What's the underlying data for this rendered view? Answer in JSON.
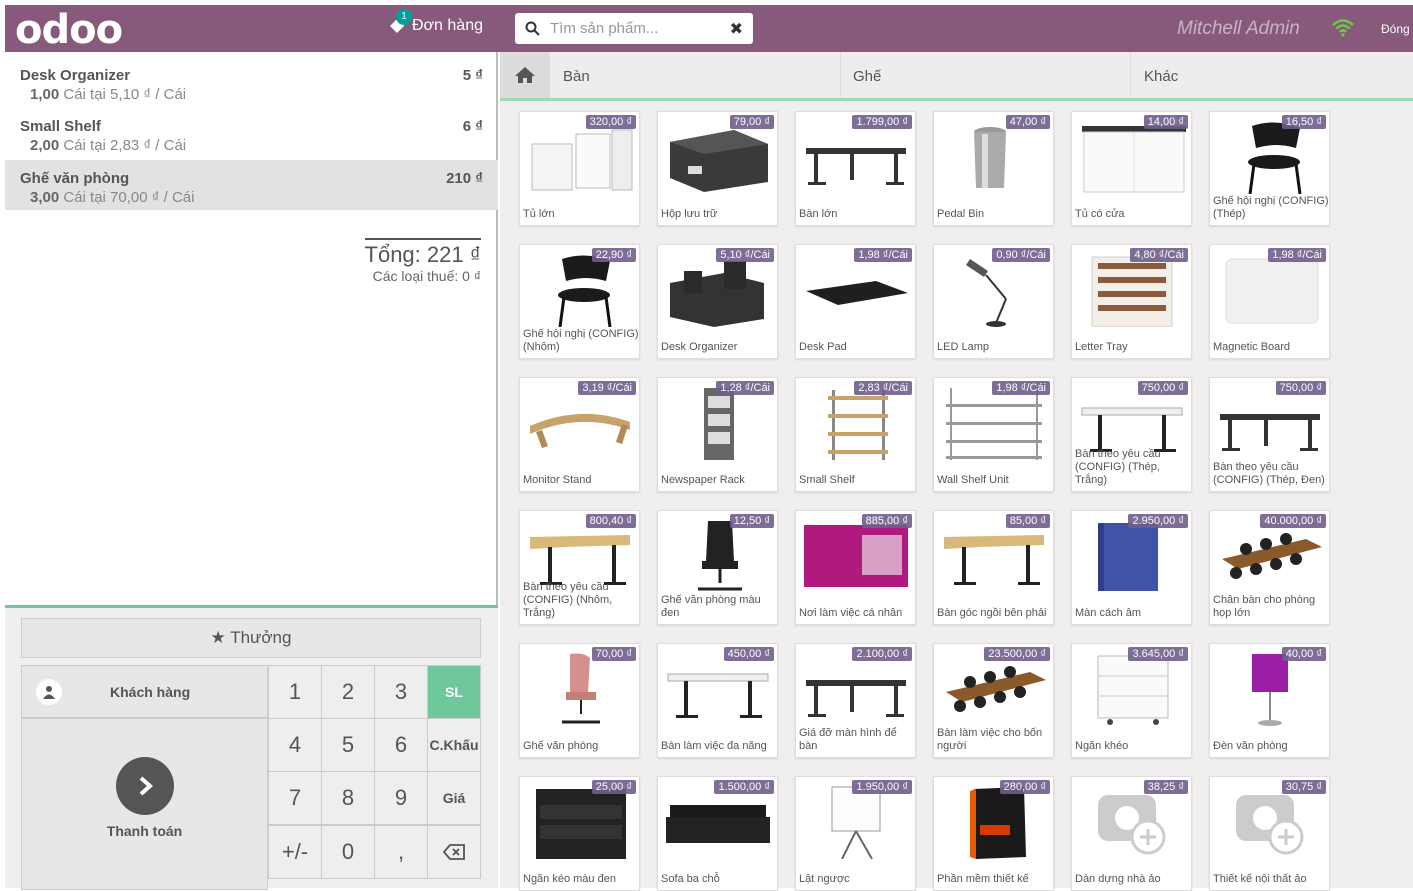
{
  "app": {
    "logo": "odoo",
    "orders_label": "Đơn hàng",
    "orders_count": "1",
    "search_placeholder": "Tìm sản phẩm...",
    "user": "Mitchell Admin",
    "close_label": "Đóng"
  },
  "order": {
    "lines": [
      {
        "name": "Desk Organizer",
        "price": "5 ₫",
        "qty": "1,00",
        "info": "Cái tại 5,10 ₫ / Cái"
      },
      {
        "name": "Small Shelf",
        "price": "6 ₫",
        "qty": "2,00",
        "info": "Cái tại 2,83 ₫ / Cái"
      },
      {
        "name": "Ghế văn phòng",
        "price": "210 ₫",
        "qty": "3,00",
        "info": "Cái tại 70,00 ₫ / Cái"
      }
    ],
    "total": "Tổng: 221 ₫",
    "taxes": "Các loại thuế: 0 ₫"
  },
  "pad": {
    "reward": "Thưởng",
    "customer": "Khách hàng",
    "payment": "Thanh toán",
    "keys": [
      "1",
      "2",
      "3",
      "SL",
      "4",
      "5",
      "6",
      "C.Khấu",
      "7",
      "8",
      "9",
      "Giá",
      "+/-",
      "0",
      ","
    ],
    "active_key": "SL"
  },
  "categories": [
    "Bàn",
    "Ghế",
    "Khác"
  ],
  "products": [
    {
      "name": "Tủ lớn",
      "price": "320,00 ₫",
      "icon": "cabinet"
    },
    {
      "name": "Hộp lưu trữ",
      "price": "79,00 ₫",
      "icon": "box"
    },
    {
      "name": "Bàn lớn",
      "price": "1.799,00 ₫",
      "icon": "desk-dark"
    },
    {
      "name": "Pedal Bin",
      "price": "47,00 ₫",
      "icon": "bin"
    },
    {
      "name": "Tủ có cửa",
      "price": "14,00 ₫",
      "icon": "cabinet-white"
    },
    {
      "name": "Ghế hội nghị (CONFIG) (Thép)",
      "price": "16,50 ₫",
      "icon": "chair"
    },
    {
      "name": "Ghế hội nghị (CONFIG) (Nhôm)",
      "price": "22,90 ₫",
      "icon": "chair"
    },
    {
      "name": "Desk Organizer",
      "price": "5,10 ₫/Cái",
      "icon": "organizer"
    },
    {
      "name": "Desk Pad",
      "price": "1,98 ₫/Cái",
      "icon": "pad"
    },
    {
      "name": "LED Lamp",
      "price": "0,90 ₫/Cái",
      "icon": "lamp"
    },
    {
      "name": "Letter Tray",
      "price": "4,80 ₫/Cái",
      "icon": "tray"
    },
    {
      "name": "Magnetic Board",
      "price": "1,98 ₫/Cái",
      "icon": "board"
    },
    {
      "name": "Monitor Stand",
      "price": "3,19 ₫/Cái",
      "icon": "stand"
    },
    {
      "name": "Newspaper Rack",
      "price": "1,28 ₫/Cái",
      "icon": "rack"
    },
    {
      "name": "Small Shelf",
      "price": "2,83 ₫/Cái",
      "icon": "shelf"
    },
    {
      "name": "Wall Shelf Unit",
      "price": "1,98 ₫/Cái",
      "icon": "wallshelf"
    },
    {
      "name": "Bàn theo yêu cầu (CONFIG) (Thép, Trắng)",
      "price": "750,00 ₫",
      "icon": "desk-white"
    },
    {
      "name": "Bàn theo yêu cầu (CONFIG) (Thép, Đen)",
      "price": "750,00 ₫",
      "icon": "desk-dark"
    },
    {
      "name": "Bàn theo yêu cầu (CONFIG) (Nhôm, Trắng)",
      "price": "800,40 ₫",
      "icon": "desk-wood"
    },
    {
      "name": "Ghế văn phòng màu đen",
      "price": "12,50 ₫",
      "icon": "office-chair"
    },
    {
      "name": "Nơi làm việc cá nhân",
      "price": "885,00 ₫",
      "icon": "booth"
    },
    {
      "name": "Bàn góc ngồi bên phải",
      "price": "85,00 ₫",
      "icon": "desk-wood"
    },
    {
      "name": "Màn cách âm",
      "price": "2.950,00 ₫",
      "icon": "screen"
    },
    {
      "name": "Chân bàn cho phòng họp lớn",
      "price": "40.000,00 ₫",
      "icon": "conference"
    },
    {
      "name": "Ghế văn phòng",
      "price": "70,00 ₫",
      "icon": "pink-chair"
    },
    {
      "name": "Bàn làm việc đa năng",
      "price": "450,00 ₫",
      "icon": "desk-white"
    },
    {
      "name": "Giá đỡ màn hình để bàn",
      "price": "2.100,00 ₫",
      "icon": "desk-dark"
    },
    {
      "name": "Bàn làm việc cho bốn người",
      "price": "23.500,00 ₫",
      "icon": "conference"
    },
    {
      "name": "Ngăn khéo",
      "price": "3.645,00 ₫",
      "icon": "drawer"
    },
    {
      "name": "Đèn văn phòng",
      "price": "40,00 ₫",
      "icon": "purple-lamp"
    },
    {
      "name": "Ngăn kéo màu đen",
      "price": "25,00 ₫",
      "icon": "black-drawer"
    },
    {
      "name": "Sofa ba chỗ",
      "price": "1.500,00 ₫",
      "icon": "sofa"
    },
    {
      "name": "Lật ngược",
      "price": "1.950,00 ₫",
      "icon": "flipchart"
    },
    {
      "name": "Phần mềm thiết kế",
      "price": "280,00 ₫",
      "icon": "software"
    },
    {
      "name": "Dàn dựng nhà ảo",
      "price": "38,25 ₫",
      "icon": "placeholder"
    },
    {
      "name": "Thiết kế nội thất ảo",
      "price": "30,75 ₫",
      "icon": "placeholder"
    }
  ]
}
